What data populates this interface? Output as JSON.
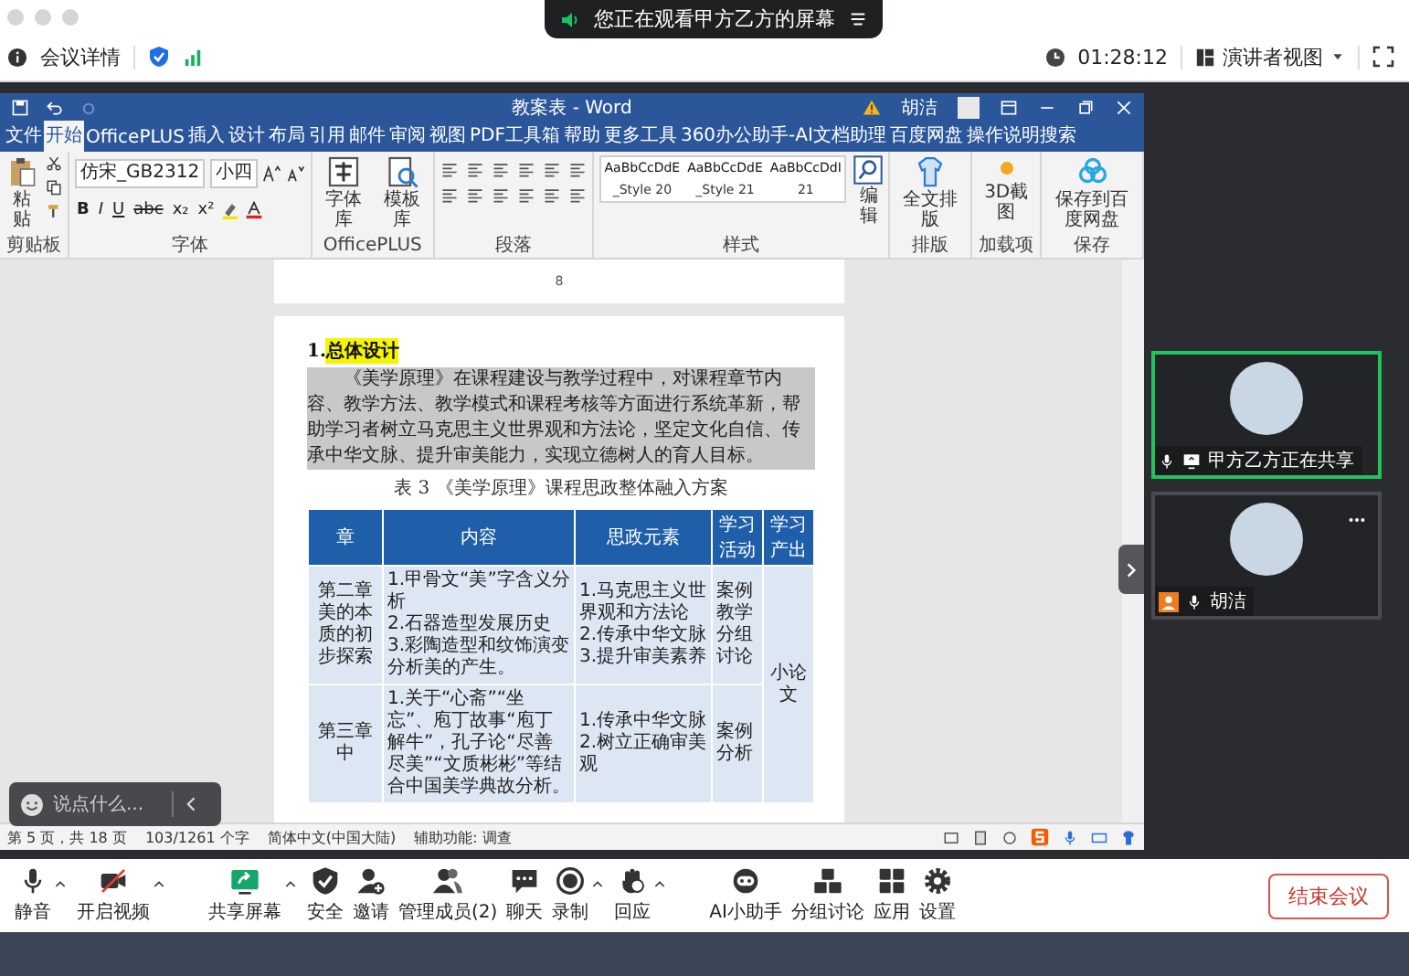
{
  "meeting_bar": {
    "info": "会议详情",
    "timer": "01:28:12",
    "view_mode": "演讲者视图"
  },
  "share_banner": {
    "text": "您正在观看甲方乙方的屏幕"
  },
  "shared_window": {
    "title": "教案表 - Word",
    "user": "胡洁",
    "tabs": [
      {
        "label": "文件",
        "selected": false
      },
      {
        "label": "开始",
        "selected": true
      },
      {
        "label": "OfficePLUS",
        "selected": false
      },
      {
        "label": "插入",
        "selected": false
      },
      {
        "label": "设计",
        "selected": false
      },
      {
        "label": "布局",
        "selected": false
      },
      {
        "label": "引用",
        "selected": false
      },
      {
        "label": "邮件",
        "selected": false
      },
      {
        "label": "审阅",
        "selected": false
      },
      {
        "label": "视图",
        "selected": false
      },
      {
        "label": "PDF工具箱",
        "selected": false
      },
      {
        "label": "帮助",
        "selected": false
      },
      {
        "label": "更多工具",
        "selected": false
      },
      {
        "label": "360办公助手-AI文档助理",
        "selected": false
      },
      {
        "label": "百度网盘",
        "selected": false
      },
      {
        "label": "操作说明搜索",
        "selected": false
      }
    ],
    "ribbon": {
      "paste": "粘贴",
      "font": "仿宋_GB2312",
      "size": "小四",
      "font_buttons": [
        "B",
        "I",
        "U",
        "abc",
        "x₂",
        "x²"
      ],
      "officeplus": [
        "字体库",
        "模板库"
      ],
      "styles": [
        {
          "preview": "AaBbCcDdE",
          "name": "_Style 20"
        },
        {
          "preview": "AaBbCcDdE",
          "name": "_Style 21"
        },
        {
          "preview": "AaBbCcDdI",
          "name": "21"
        }
      ],
      "editing": "编辑",
      "layout": "全文排版",
      "addin": "3D截图",
      "save": "保存到百度网盘",
      "groups": [
        "剪贴板",
        "字体",
        "OfficePLUS",
        "段落",
        "样式",
        "排版",
        "加载项",
        "保存"
      ]
    },
    "document": {
      "page_number": "8",
      "heading_number": "1.",
      "heading": "总体设计",
      "paragraph": {
        "text": "《美学原理》在课程建设与教学过程中，对课程章节内容、教学方法、教学模式和课程考核等方面进行系统革新，帮助学习者树立马克思主义世界观和方法论，坚定文化自信、传承中华文脉、提升审美能力，实现立德树人的育人目标。",
        "selected": true
      },
      "caption": "表 3 《美学原理》课程思政整体融入方案",
      "table": {
        "columns": [
          "章",
          "内容",
          "思政元素",
          "学习活动",
          "学习产出"
        ],
        "rows": [
          [
            "第二章美的本质的初步探索",
            "1.甲骨文“美”字含义分析\n2.石器造型发展历史\n3.彩陶造型和纹饰演变分析美的产生。",
            "1.马克思主义世界观和方法论\n2.传承中华文脉\n3.提升审美素养",
            "案例教学分组讨论"
          ],
          [
            "第三章中",
            "1.关于“心斋”“坐忘”、庖丁故事“庖丁解牛”，孔子论“尽善尽美”“文质彬彬”等结合中国美学典故分析。",
            "1.传承中华文脉\n2.树立正确审美观",
            "案例分析"
          ]
        ],
        "output": "小论文"
      }
    },
    "status_bar": [
      "第 5 页，共 18 页",
      "103/1261 个字",
      "简体中文(中国大陆)",
      "辅助功能: 调查"
    ]
  },
  "chat_input": {
    "placeholder": "说点什么..."
  },
  "participants": [
    {
      "name": "甲方乙方正在共享",
      "active": true,
      "sharing": true,
      "host": false
    },
    {
      "name": "胡洁",
      "active": false,
      "sharing": false,
      "host": true
    }
  ],
  "toolbar": [
    {
      "label": "静音",
      "kind": "mic",
      "menu": true
    },
    {
      "label": "开启视频",
      "kind": "video",
      "menu": true
    },
    {
      "label": "共享屏幕",
      "kind": "share",
      "menu": true
    },
    {
      "label": "安全",
      "kind": "shield",
      "menu": false
    },
    {
      "label": "邀请",
      "kind": "invite",
      "menu": false
    },
    {
      "label": "管理成员(2)",
      "kind": "members",
      "menu": false
    },
    {
      "label": "聊天",
      "kind": "chat",
      "menu": false
    },
    {
      "label": "录制",
      "kind": "record",
      "menu": true
    },
    {
      "label": "回应",
      "kind": "hand",
      "menu": true
    },
    {
      "label": "AI小助手",
      "kind": "robot",
      "menu": false
    },
    {
      "label": "分组讨论",
      "kind": "blocks",
      "menu": false
    },
    {
      "label": "应用",
      "kind": "apps",
      "menu": false
    },
    {
      "label": "设置",
      "kind": "gear",
      "menu": false
    }
  ],
  "end_button": "结束会议"
}
